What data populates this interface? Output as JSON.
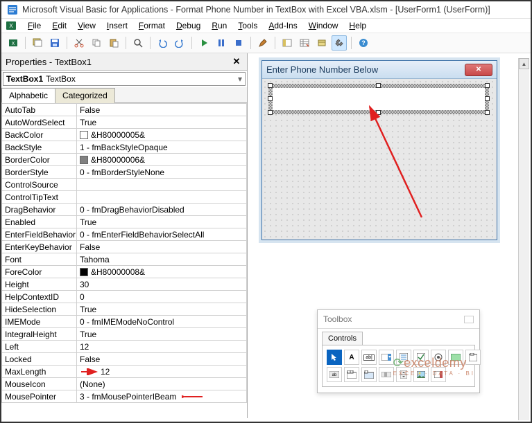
{
  "title": "Microsoft Visual Basic for Applications - Format Phone Number in TextBox with Excel VBA.xlsm - [UserForm1 (UserForm)]",
  "menus": [
    "File",
    "Edit",
    "View",
    "Insert",
    "Format",
    "Debug",
    "Run",
    "Tools",
    "Add-Ins",
    "Window",
    "Help"
  ],
  "truncated_header": "Properties - TextBox1",
  "object_name": "TextBox1",
  "object_type": "TextBox",
  "tabs": {
    "alpha": "Alphabetic",
    "cat": "Categorized"
  },
  "props": [
    {
      "n": "AutoTab",
      "v": "False"
    },
    {
      "n": "AutoWordSelect",
      "v": "True"
    },
    {
      "n": "BackColor",
      "v": "&H80000005&",
      "swatch": "#ffffff"
    },
    {
      "n": "BackStyle",
      "v": "1 - fmBackStyleOpaque"
    },
    {
      "n": "BorderColor",
      "v": "&H80000006&",
      "swatch": "#808080"
    },
    {
      "n": "BorderStyle",
      "v": "0 - fmBorderStyleNone"
    },
    {
      "n": "ControlSource",
      "v": ""
    },
    {
      "n": "ControlTipText",
      "v": ""
    },
    {
      "n": "DragBehavior",
      "v": "0 - fmDragBehaviorDisabled"
    },
    {
      "n": "Enabled",
      "v": "True"
    },
    {
      "n": "EnterFieldBehavior",
      "v": "0 - fmEnterFieldBehaviorSelectAll"
    },
    {
      "n": "EnterKeyBehavior",
      "v": "False"
    },
    {
      "n": "Font",
      "v": "Tahoma"
    },
    {
      "n": "ForeColor",
      "v": "&H80000008&",
      "swatch": "#000000"
    },
    {
      "n": "Height",
      "v": "30"
    },
    {
      "n": "HelpContextID",
      "v": "0"
    },
    {
      "n": "HideSelection",
      "v": "True"
    },
    {
      "n": "IMEMode",
      "v": "0 - fmIMEModeNoControl"
    },
    {
      "n": "IntegralHeight",
      "v": "True"
    },
    {
      "n": "Left",
      "v": "12"
    },
    {
      "n": "Locked",
      "v": "False"
    },
    {
      "n": "MaxLength",
      "v": "12",
      "arrow": "left"
    },
    {
      "n": "MouseIcon",
      "v": "(None)"
    },
    {
      "n": "MousePointer",
      "v": "3 - fmMousePointerIBeam",
      "arrow": "right"
    }
  ],
  "form_caption": "Enter Phone Number Below",
  "toolbox": {
    "title": "Toolbox",
    "tab": "Controls"
  },
  "watermark": {
    "brand": "exceldemy",
    "tag": "EXCEL · DATA · BI"
  }
}
